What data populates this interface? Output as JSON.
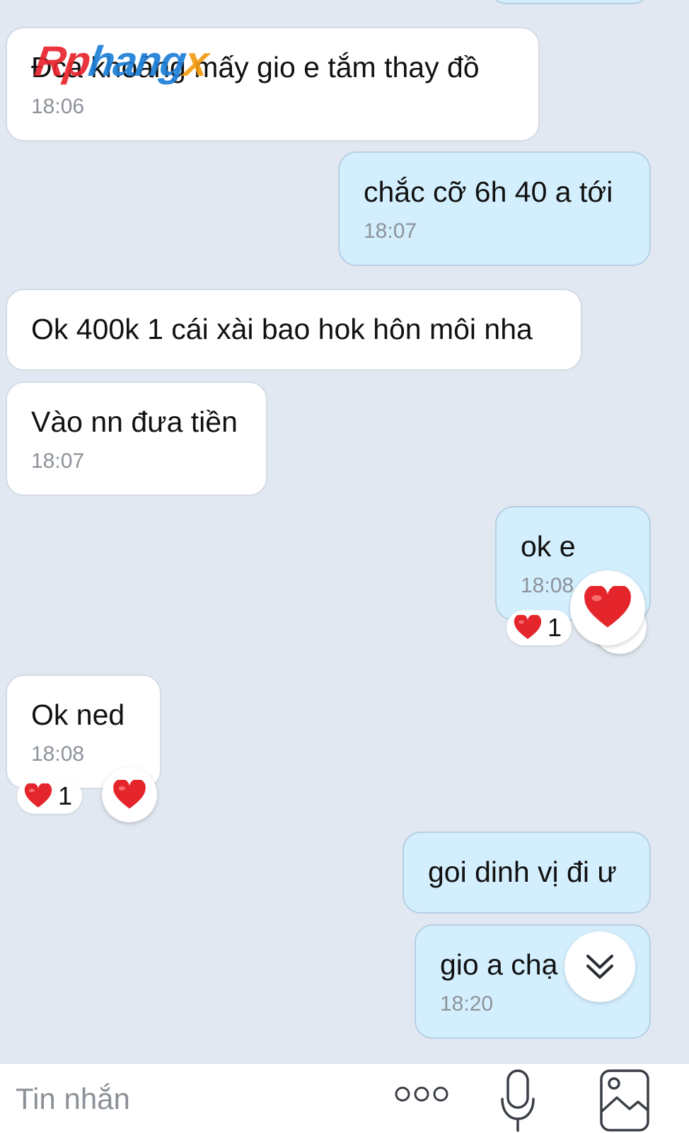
{
  "watermark": {
    "part1": "Rp",
    "part2": "hang",
    "part3": "x"
  },
  "messages": [
    {
      "id": "m1",
      "direction": "incoming",
      "text": "Đca khoảng mấy gio e tắm thay đồ",
      "time": "18:06"
    },
    {
      "id": "m2",
      "direction": "outgoing",
      "text": "chắc cỡ 6h 40 a tới",
      "time": "18:07"
    },
    {
      "id": "m3",
      "direction": "incoming",
      "text": "Ok 400k 1 cái xài bao hok hôn môi nha",
      "time": ""
    },
    {
      "id": "m4",
      "direction": "incoming",
      "text": "Vào nn đưa tiền",
      "time": "18:07"
    },
    {
      "id": "m5",
      "direction": "outgoing",
      "text": "ok e",
      "time": "18:08",
      "reaction_count": "1"
    },
    {
      "id": "m6",
      "direction": "incoming",
      "text": "Ok ned",
      "time": "18:08",
      "reaction_count": "1"
    },
    {
      "id": "m7",
      "direction": "outgoing",
      "text": "goi dinh vị đi ư",
      "time": ""
    },
    {
      "id": "m8",
      "direction": "outgoing",
      "text": "gio a chạ",
      "time": "18:20"
    }
  ],
  "compose": {
    "placeholder": "Tin nhắn"
  },
  "icons": {
    "more": "more-options-icon",
    "mic": "microphone-icon",
    "image": "image-gallery-icon",
    "scroll": "scroll-down-icon",
    "reaction": "heart-icon"
  },
  "colors": {
    "background": "#e2e8f1",
    "incoming_bubble": "#ffffff",
    "outgoing_bubble": "#d3eefd",
    "heart": "#e5252c",
    "timestamp": "#8d939a"
  }
}
